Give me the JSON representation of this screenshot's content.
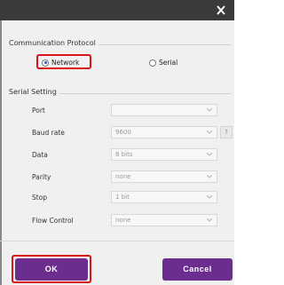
{
  "comm_protocol": {
    "title": "Communication Protocol",
    "options": [
      {
        "label": "Network",
        "selected": true
      },
      {
        "label": "Serial",
        "selected": false
      }
    ]
  },
  "serial_setting": {
    "title": "Serial Setting",
    "rows": [
      {
        "label": "Port",
        "value": ""
      },
      {
        "label": "Baud rate",
        "value": "9600"
      },
      {
        "label": "Data",
        "value": "8 bits"
      },
      {
        "label": "Parity",
        "value": "none"
      },
      {
        "label": "Stop",
        "value": "1 bit"
      },
      {
        "label": "Flow Control",
        "value": "none"
      }
    ],
    "help_label": "?"
  },
  "buttons": {
    "ok": "OK",
    "cancel": "Cancel"
  },
  "colors": {
    "button_bg": "#6b2d8e",
    "highlight": "#d8141a",
    "titlebar": "#3b3b3b"
  },
  "icons": {
    "close": "close-icon"
  }
}
